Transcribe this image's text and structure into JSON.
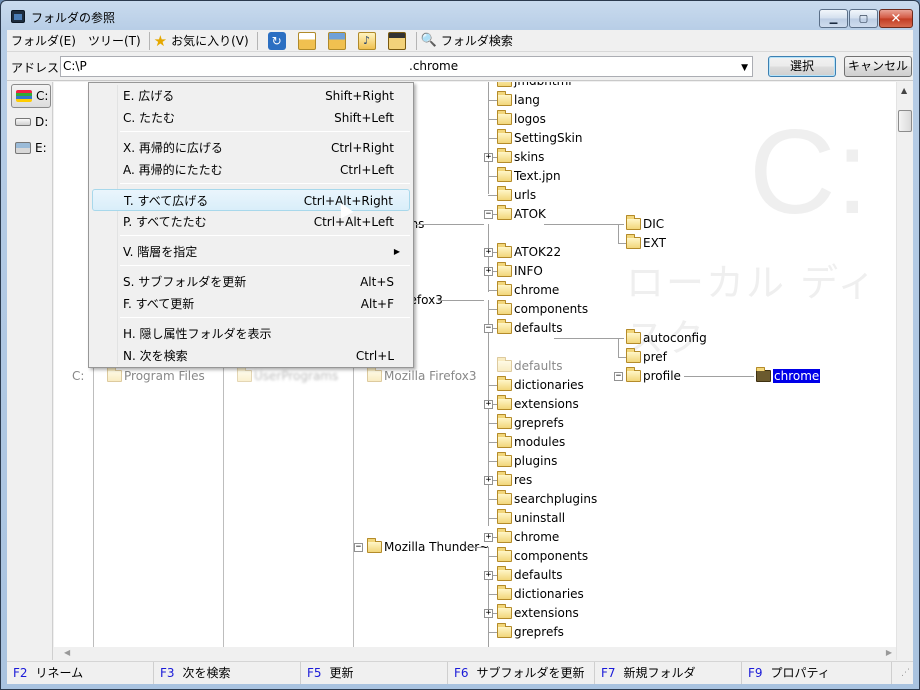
{
  "window": {
    "title": "フォルダの参照"
  },
  "menubar": {
    "items": [
      "フォルダ(E)",
      "ツリー(T)",
      "お気に入り(V)"
    ],
    "search_label": "フォルダ検索"
  },
  "toolbar_icons": [
    "refresh-icon",
    "printer-icon",
    "print-preview-icon",
    "folder-music-icon",
    "film-icon"
  ],
  "address": {
    "label": "アドレス",
    "value_prefix": "C:\\P",
    "value_suffix": ".chrome"
  },
  "buttons": {
    "select": "選択",
    "cancel": "キャンセル"
  },
  "drives": [
    {
      "label": "C:",
      "icon": "system-drive-icon",
      "selected": true
    },
    {
      "label": "D:",
      "icon": "drive-icon",
      "selected": false
    },
    {
      "label": "E:",
      "icon": "network-drive-icon",
      "selected": false
    }
  ],
  "context_menu": {
    "items": [
      {
        "label": "E. 広げる",
        "shortcut": "Shift+Right"
      },
      {
        "label": "C. たたむ",
        "shortcut": "Shift+Left"
      },
      {
        "label": "X. 再帰的に広げる",
        "shortcut": "Ctrl+Right"
      },
      {
        "label": "A. 再帰的にたたむ",
        "shortcut": "Ctrl+Left"
      },
      {
        "label": "T. すべて広げる",
        "shortcut": "Ctrl+Alt+Right"
      },
      {
        "label": "P. すべてたたむ",
        "shortcut": "Ctrl+Alt+Left"
      },
      {
        "label": "V. 階層を指定",
        "shortcut": ""
      },
      {
        "label": "S. サブフォルダを更新",
        "shortcut": "Alt+S"
      },
      {
        "label": "F. すべて更新",
        "shortcut": "Alt+F"
      },
      {
        "label": "H. 隠し属性フォルダを表示",
        "shortcut": ""
      },
      {
        "label": "N. 次を検索",
        "shortcut": "Ctrl+L"
      }
    ],
    "hovered_index": 4
  },
  "tree": {
    "path_row": {
      "drive": "C:",
      "level1": "Program Files",
      "level2": "(blurred)",
      "level3": "Mozilla Firefox3",
      "level4": "defaults"
    },
    "partial_labels": {
      "systems": "ystems",
      "firefox": "la Firefox3"
    },
    "col4": [
      "jmdbhtml",
      "lang",
      "logos",
      "SettingSkin",
      "skins",
      "Text.jpn",
      "urls",
      "ATOK",
      "ATOK22",
      "INFO",
      "chrome",
      "components",
      "defaults",
      "defaults",
      "dictionaries",
      "extensions",
      "greprefs",
      "modules",
      "plugins",
      "res",
      "searchplugins",
      "uninstall",
      "chrome",
      "components",
      "defaults",
      "dictionaries",
      "extensions",
      "greprefs"
    ],
    "col3_thunderbird": "Mozilla Thunder~",
    "atok_children": [
      "DIC",
      "EXT"
    ],
    "defaults_children": [
      "autoconfig",
      "pref",
      "profile"
    ],
    "selected": "chrome"
  },
  "watermark": {
    "drive": "C:",
    "type": "ローカル ディスク"
  },
  "statusbar": [
    {
      "key": "F2",
      "label": "リネーム"
    },
    {
      "key": "F3",
      "label": "次を検索"
    },
    {
      "key": "F5",
      "label": "更新"
    },
    {
      "key": "F6",
      "label": "サブフォルダを更新"
    },
    {
      "key": "F7",
      "label": "新規フォルダ"
    },
    {
      "key": "F9",
      "label": "プロパティ"
    }
  ]
}
